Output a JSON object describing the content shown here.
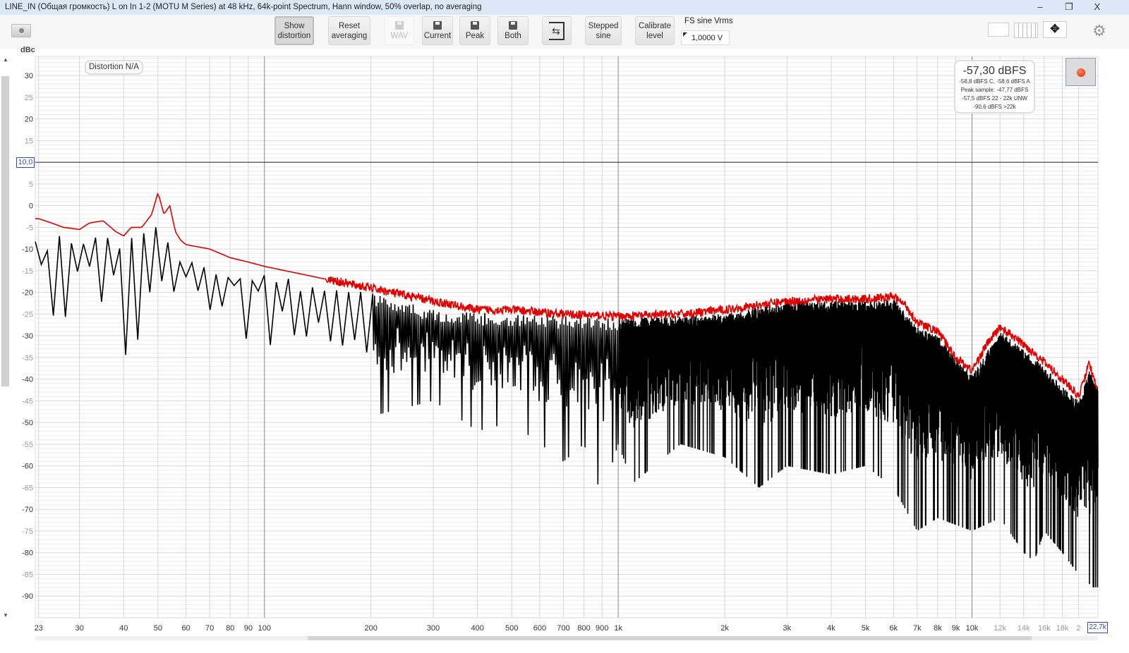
{
  "window": {
    "title": "LINE_IN (Общая громкость) L on In 1-2 (MOTU M Series) at 48 kHz, 64k-point Spectrum, Hann window, 50% overlap, no averaging",
    "minimize": "–",
    "restore": "❐",
    "close": "X"
  },
  "toolbar": {
    "show_distortion": [
      "Show",
      "distortion"
    ],
    "reset_averaging": [
      "Reset",
      "averaging"
    ],
    "wav": "WAV",
    "current": "Current",
    "peak": "Peak",
    "both": "Both",
    "stepped_sine": [
      "Stepped",
      "sine"
    ],
    "calibrate_level": [
      "Calibrate",
      "level"
    ],
    "fs_label": "FS sine Vrms",
    "fs_value": "1,0000 V"
  },
  "icons": {
    "snapshot": "camera-icon",
    "import": "import-icon",
    "layout1": "monitor-icon",
    "layout2": "columns-icon",
    "layout3": "move-arrows-icon",
    "settings": "gear-icon",
    "record": "record-icon"
  },
  "readout": {
    "main": "-57,30 dBFS",
    "lines": [
      "-58,8 dBFS C, -58,6 dBFS A",
      "Peak sample: -47,77 dBFS",
      "-57,5 dBFS 22 - 22k UNW",
      "-90,6 dBFS >22k"
    ]
  },
  "distortion_badge": "Distortion N/A",
  "cursor": {
    "y_label": "10,0",
    "x_label": "22,7k"
  },
  "chart_data": {
    "type": "line",
    "ylabel": "dBc",
    "xscale": "log",
    "xlim": [
      22.5,
      22700
    ],
    "ylim": [
      -95,
      34.4
    ],
    "grid": true,
    "y_ticks": [
      30,
      25,
      20,
      15,
      10,
      5,
      0,
      -5,
      -10,
      -15,
      -20,
      -25,
      -30,
      -35,
      -40,
      -45,
      -50,
      -55,
      -60,
      -65,
      -70,
      -75,
      -80,
      -85,
      -90
    ],
    "x_ticks": [
      {
        "v": 23,
        "l": "23"
      },
      {
        "v": 30,
        "l": "30"
      },
      {
        "v": 40,
        "l": "40"
      },
      {
        "v": 50,
        "l": "50"
      },
      {
        "v": 60,
        "l": "60"
      },
      {
        "v": 70,
        "l": "70"
      },
      {
        "v": 80,
        "l": "80"
      },
      {
        "v": 90,
        "l": "90"
      },
      {
        "v": 100,
        "l": "100"
      },
      {
        "v": 200,
        "l": "200"
      },
      {
        "v": 300,
        "l": "300"
      },
      {
        "v": 400,
        "l": "400"
      },
      {
        "v": 500,
        "l": "500"
      },
      {
        "v": 600,
        "l": "600"
      },
      {
        "v": 700,
        "l": "700"
      },
      {
        "v": 800,
        "l": "800"
      },
      {
        "v": 900,
        "l": "900"
      },
      {
        "v": 1000,
        "l": "1k"
      },
      {
        "v": 2000,
        "l": "2k"
      },
      {
        "v": 3000,
        "l": "3k"
      },
      {
        "v": 4000,
        "l": "4k"
      },
      {
        "v": 5000,
        "l": "5k"
      },
      {
        "v": 6000,
        "l": "6k"
      },
      {
        "v": 7000,
        "l": "7k"
      },
      {
        "v": 8000,
        "l": "8k"
      },
      {
        "v": 9000,
        "l": "9k"
      },
      {
        "v": 10000,
        "l": "10k"
      },
      {
        "v": 12000,
        "l": "12k"
      },
      {
        "v": 14000,
        "l": "14k"
      },
      {
        "v": 16000,
        "l": "16k"
      },
      {
        "v": 18000,
        "l": "18k"
      },
      {
        "v": 20000,
        "l": "2"
      }
    ],
    "cursor_y": 10,
    "series": [
      {
        "key": "peak",
        "color": "#e00000",
        "points": [
          [
            23,
            -3
          ],
          [
            25,
            -4
          ],
          [
            27,
            -5
          ],
          [
            30,
            -5.5
          ],
          [
            32,
            -4
          ],
          [
            35,
            -3.5
          ],
          [
            38,
            -6
          ],
          [
            40,
            -7
          ],
          [
            42,
            -5
          ],
          [
            45,
            -5
          ],
          [
            48,
            -2
          ],
          [
            50,
            3
          ],
          [
            52,
            -2
          ],
          [
            54,
            0
          ],
          [
            56,
            -6
          ],
          [
            58,
            -8
          ],
          [
            60,
            -9
          ],
          [
            70,
            -10
          ],
          [
            80,
            -12
          ],
          [
            90,
            -13
          ],
          [
            100,
            -14
          ],
          [
            150,
            -17
          ],
          [
            200,
            -19
          ],
          [
            300,
            -22
          ],
          [
            400,
            -24
          ],
          [
            500,
            -24
          ],
          [
            700,
            -25
          ],
          [
            1000,
            -25.5
          ],
          [
            1500,
            -25
          ],
          [
            2000,
            -24
          ],
          [
            3000,
            -22
          ],
          [
            4000,
            -21.5
          ],
          [
            5000,
            -21.5
          ],
          [
            6000,
            -21
          ],
          [
            6500,
            -23
          ],
          [
            7000,
            -27
          ],
          [
            8000,
            -29
          ],
          [
            9000,
            -35
          ],
          [
            10000,
            -38
          ],
          [
            11000,
            -32
          ],
          [
            12000,
            -28
          ],
          [
            13000,
            -30
          ],
          [
            15000,
            -34
          ],
          [
            18000,
            -40
          ],
          [
            20000,
            -44
          ],
          [
            21500,
            -36
          ],
          [
            22000,
            -40
          ],
          [
            22700,
            -42
          ]
        ]
      },
      {
        "key": "current",
        "color": "#000000",
        "upper": [
          [
            23,
            -8
          ],
          [
            30,
            -6
          ],
          [
            40,
            -7
          ],
          [
            48,
            -5
          ],
          [
            50,
            -1
          ],
          [
            55,
            -8
          ],
          [
            60,
            -12
          ],
          [
            100,
            -15
          ],
          [
            200,
            -20
          ],
          [
            300,
            -24
          ],
          [
            500,
            -25
          ],
          [
            1000,
            -26
          ],
          [
            2000,
            -25
          ],
          [
            3000,
            -22
          ],
          [
            4000,
            -22
          ],
          [
            5000,
            -22
          ],
          [
            6000,
            -21.5
          ],
          [
            7000,
            -28
          ],
          [
            8000,
            -30
          ],
          [
            10000,
            -39
          ],
          [
            12000,
            -29
          ],
          [
            15000,
            -35
          ],
          [
            20000,
            -45
          ],
          [
            21500,
            -38
          ],
          [
            22700,
            -42
          ]
        ],
        "lower": [
          [
            23,
            -25
          ],
          [
            30,
            -26
          ],
          [
            40,
            -35
          ],
          [
            50,
            -25
          ],
          [
            70,
            -30
          ],
          [
            100,
            -31
          ],
          [
            150,
            -43
          ],
          [
            170,
            -50
          ],
          [
            300,
            -45
          ],
          [
            400,
            -52
          ],
          [
            500,
            -50
          ],
          [
            700,
            -59
          ],
          [
            800,
            -55
          ],
          [
            900,
            -67
          ],
          [
            1000,
            -55
          ],
          [
            1100,
            -64
          ],
          [
            1500,
            -55
          ],
          [
            2000,
            -58
          ],
          [
            2500,
            -65
          ],
          [
            3000,
            -60
          ],
          [
            4000,
            -62
          ],
          [
            5000,
            -60
          ],
          [
            6000,
            -65
          ],
          [
            7000,
            -75
          ],
          [
            8000,
            -72
          ],
          [
            10000,
            -75
          ],
          [
            12000,
            -72
          ],
          [
            14000,
            -80
          ],
          [
            15000,
            -82
          ],
          [
            16000,
            -75
          ],
          [
            18000,
            -80
          ],
          [
            20000,
            -85
          ],
          [
            22000,
            -88
          ]
        ]
      }
    ]
  }
}
